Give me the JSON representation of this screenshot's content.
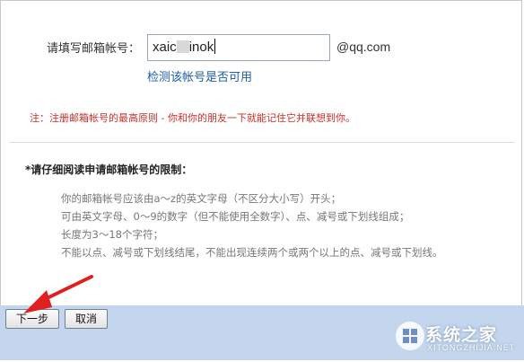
{
  "form": {
    "label": "请填写邮箱帐号：",
    "input_prefix": "xaic",
    "input_suffix": "inok",
    "domain": "@qq.com",
    "check_link": "检测该帐号是否可用"
  },
  "notice": "注：注册邮箱帐号的最高原则 - 你和你的朋友一下就能记住它并联想到你。",
  "rules": {
    "title": "*请仔细阅读申请邮箱帐号的限制：",
    "items": [
      "你的邮箱帐号应该由a～z的英文字母（不区分大小写）开头；",
      "可由英文字母、0～9的数字（但不能使用全数字）、点、减号或下划线组成；",
      "长度为3～18个字符；",
      "不能以点、减号或下划线结尾，不能出现连续两个或两个以上的点、减号或下划线。"
    ]
  },
  "buttons": {
    "next": "下一步",
    "cancel": "取消"
  },
  "watermark": {
    "text": "系统之家",
    "sub": "XITONGZHIJIA.NET"
  },
  "colors": {
    "notice": "#c8302a",
    "link": "#1f5fa8",
    "footer": "#c3d6ee",
    "arrow": "#e02020"
  }
}
